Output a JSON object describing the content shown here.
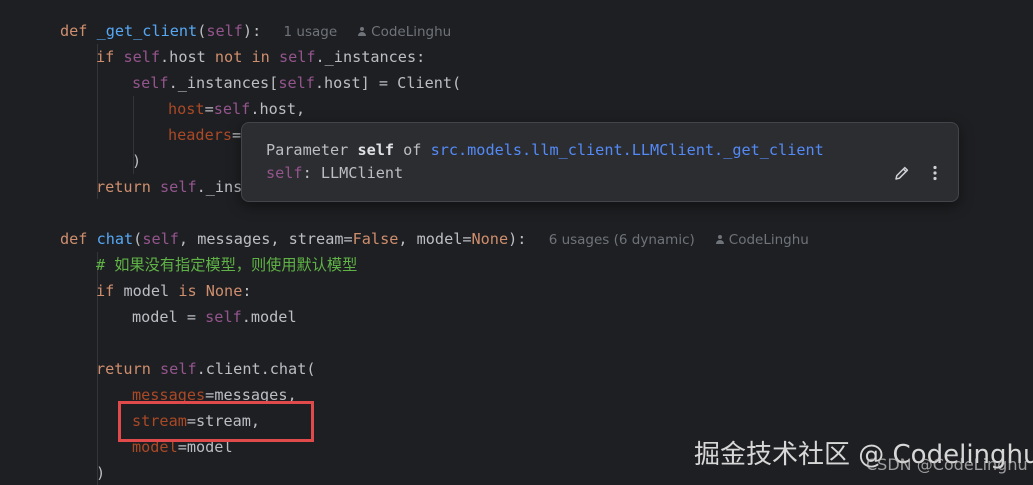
{
  "code": {
    "line1": {
      "kw": "def",
      "fn": "_get_client",
      "open": "(",
      "self": "self",
      "close": "):",
      "usages": "1 usage",
      "author": "CodeLinghu"
    },
    "line2": {
      "kw1": "if",
      "self": "self",
      "attr": ".host ",
      "kw2": "not in",
      "sp": " ",
      "self2": "self",
      "rest": "._instances:"
    },
    "line3": {
      "self": "self",
      "mid": "._instances[",
      "self2": "self",
      "rest": ".host] = Client("
    },
    "line4": {
      "param": "host",
      "eq": "=",
      "self": "self",
      "rest": ".host,"
    },
    "line5": {
      "param": "headers",
      "eq": "="
    },
    "line6": {
      "text": ")"
    },
    "line7": {
      "kw": "return",
      "sp": " ",
      "self": "self",
      "rest": "._ins"
    },
    "line8": {
      "kw": "def",
      "fn": "chat",
      "open": "(",
      "self": "self",
      "params1": ", messages, stream=",
      "false": "False",
      "params2": ", model=",
      "none": "None",
      "close": "):",
      "usages": "6 usages (6 dynamic)",
      "author": "CodeLinghu"
    },
    "line9": {
      "comment": "# 如果没有指定模型，则使用默认模型"
    },
    "line10": {
      "kw1": "if",
      "mid": " model ",
      "kw2": "is",
      "sp": " ",
      "none": "None",
      "colon": ":"
    },
    "line11": {
      "pre": "model = ",
      "self": "self",
      "rest": ".model"
    },
    "line12": {
      "kw": "return",
      "sp": " ",
      "self": "self",
      "rest": ".client.chat("
    },
    "line13": {
      "param": "messages",
      "eq": "=",
      "rest": "messages,"
    },
    "line14": {
      "param": "stream",
      "eq": "=",
      "rest": "stream,"
    },
    "line15": {
      "param": "model",
      "eq": "=",
      "rest": "model"
    },
    "line16": {
      "text": ")"
    }
  },
  "popup": {
    "prefix": "Parameter ",
    "name": "self",
    "of": " of ",
    "qualified": "src.models.llm_client.LLMClient._get_client",
    "type_self": "self",
    "type_rest": ": LLMClient",
    "edit_icon": "pencil-icon",
    "more_icon": "more-vertical-icon"
  },
  "watermark": {
    "main": "掘金技术社区 @ Codelinghu",
    "sub": "CSDN @CodeLinghu"
  },
  "colors": {
    "background": "#1e1f22",
    "keyword": "#cf8e6d",
    "function": "#56a8f5",
    "self": "#94558d",
    "comment": "#5fb346",
    "named_arg": "#aa4926",
    "link": "#548af7",
    "highlight": "#e04a4a"
  }
}
